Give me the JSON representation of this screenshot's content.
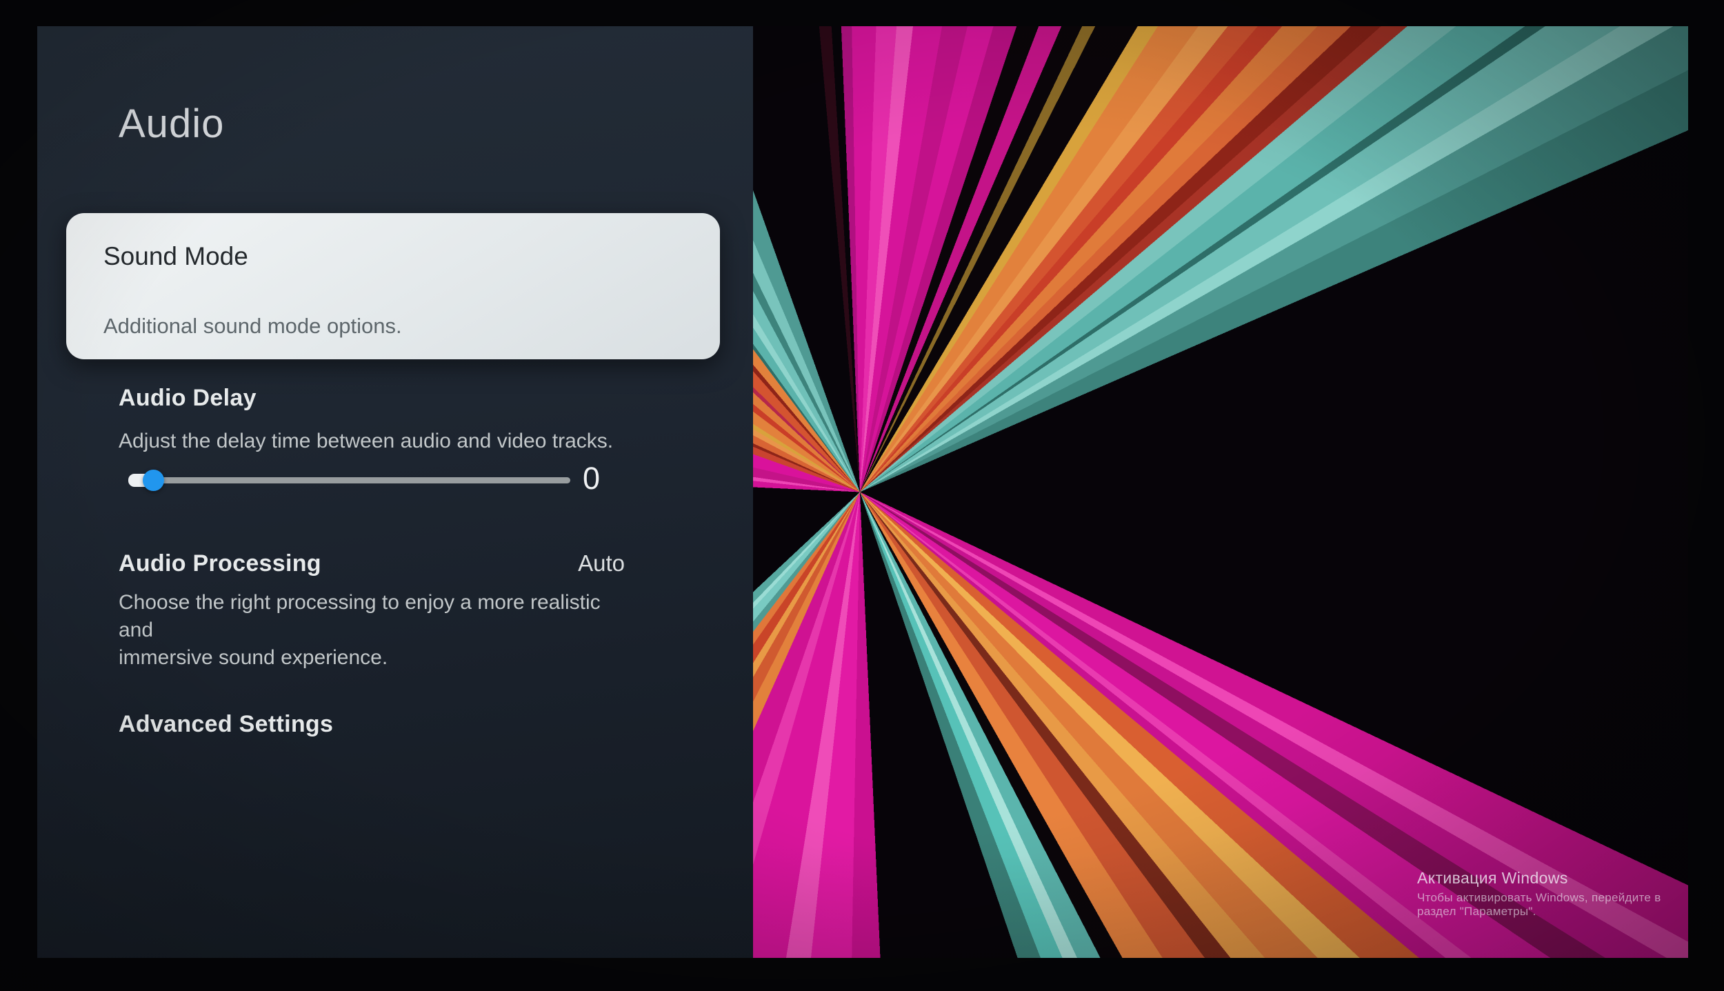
{
  "panel": {
    "title": "Audio",
    "sound_mode_card": {
      "title": "Sound Mode",
      "description": "Additional sound mode options."
    },
    "audio_delay": {
      "label": "Audio Delay",
      "description": "Adjust the delay time between audio and video tracks.",
      "value": "0"
    },
    "audio_processing": {
      "label": "Audio Processing",
      "value": "Auto",
      "lines": [
        "Choose the right processing to enjoy a more realistic and",
        "immersive sound experience."
      ]
    },
    "advanced_settings": {
      "label": "Advanced Settings"
    }
  },
  "watermark": {
    "line1": "Активация Windows",
    "line2": "Чтобы активировать Windows, перейдите в раздел \"Параметры\"."
  },
  "colors": {
    "panel_background": "#1e2631",
    "focused_card": "#e9edef",
    "slider_thumb_blue": "#2196ee",
    "ray_magenta": "#d6149a",
    "ray_orange": "#e2813c",
    "ray_gold": "#f0b050",
    "ray_teal": "#6fc0b8",
    "ray_dark_red": "#8e2418"
  }
}
